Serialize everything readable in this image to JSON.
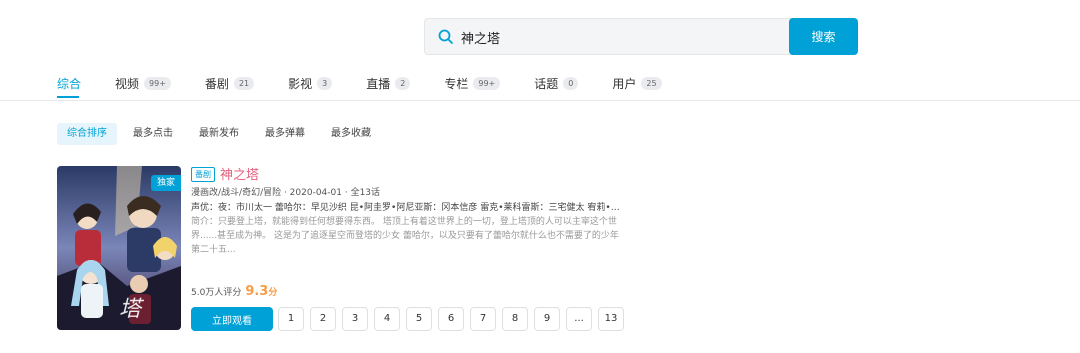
{
  "search": {
    "value": "神之塔",
    "button_label": "搜索"
  },
  "tabs": [
    {
      "label": "综合",
      "count": ""
    },
    {
      "label": "视频",
      "count": "99+"
    },
    {
      "label": "番剧",
      "count": "21"
    },
    {
      "label": "影视",
      "count": "3"
    },
    {
      "label": "直播",
      "count": "2"
    },
    {
      "label": "专栏",
      "count": "99+"
    },
    {
      "label": "话题",
      "count": "0"
    },
    {
      "label": "用户",
      "count": "25"
    }
  ],
  "sort": [
    "综合排序",
    "最多点击",
    "最新发布",
    "最多弹幕",
    "最多收藏"
  ],
  "result": {
    "badge": "独家",
    "type_tag": "番剧",
    "title": "神之塔",
    "meta": "漫画改/战斗/奇幻/冒险 · 2020-04-01 · 全13话",
    "cast": "声优：夜：市川太一 蕾哈尔：早见沙织 昆•阿圭罗•阿尼亚斯：冈本信彦 雷克•莱科雷斯：三宅健太 宥莉•吉黑...",
    "description": "简介：只要登上塔，就能得到任何想要得东西。 塔顶上有着这世界上的一切，登上塔顶的人可以主宰这个世界......甚至成为神。 这是为了追逐星空而登塔的少女 蕾哈尔，以及只要有了蕾哈尔就什么也不需要了的少年 第二十五...",
    "rating_count": "5.0万人评分",
    "score": "9.3",
    "score_unit": "分",
    "watch_label": "立即观看",
    "episodes": [
      "1",
      "2",
      "3",
      "4",
      "5",
      "6",
      "7",
      "8",
      "9",
      "...",
      "13"
    ]
  },
  "colors": {
    "accent": "#00a1d6",
    "title": "#e4607d",
    "score": "#f89c46"
  }
}
